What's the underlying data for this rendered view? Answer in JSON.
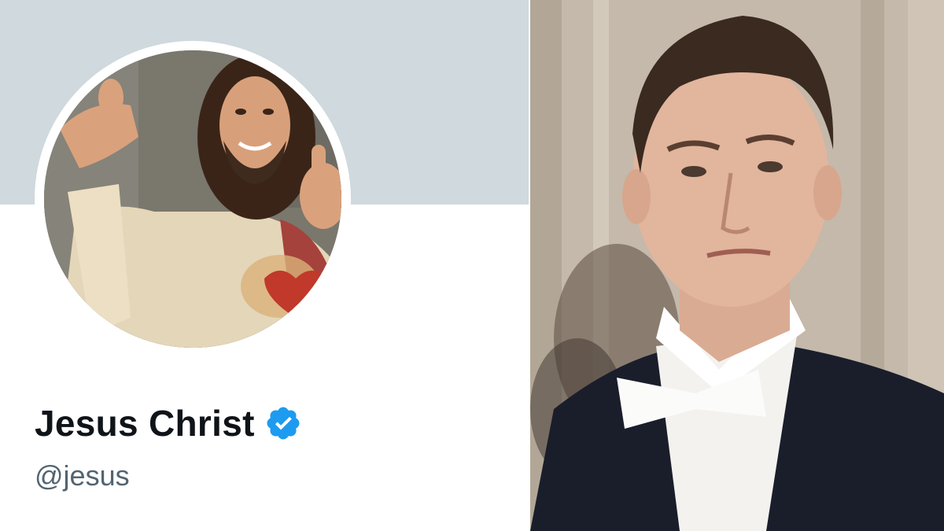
{
  "profile": {
    "display_name": "Jesus Christ",
    "handle": "@jesus",
    "verified": true,
    "badge_icon": "verified-check-icon",
    "colors": {
      "banner": "#cfd9de",
      "name": "#0f1419",
      "handle": "#536471",
      "badge": "#1d9bf0"
    }
  }
}
